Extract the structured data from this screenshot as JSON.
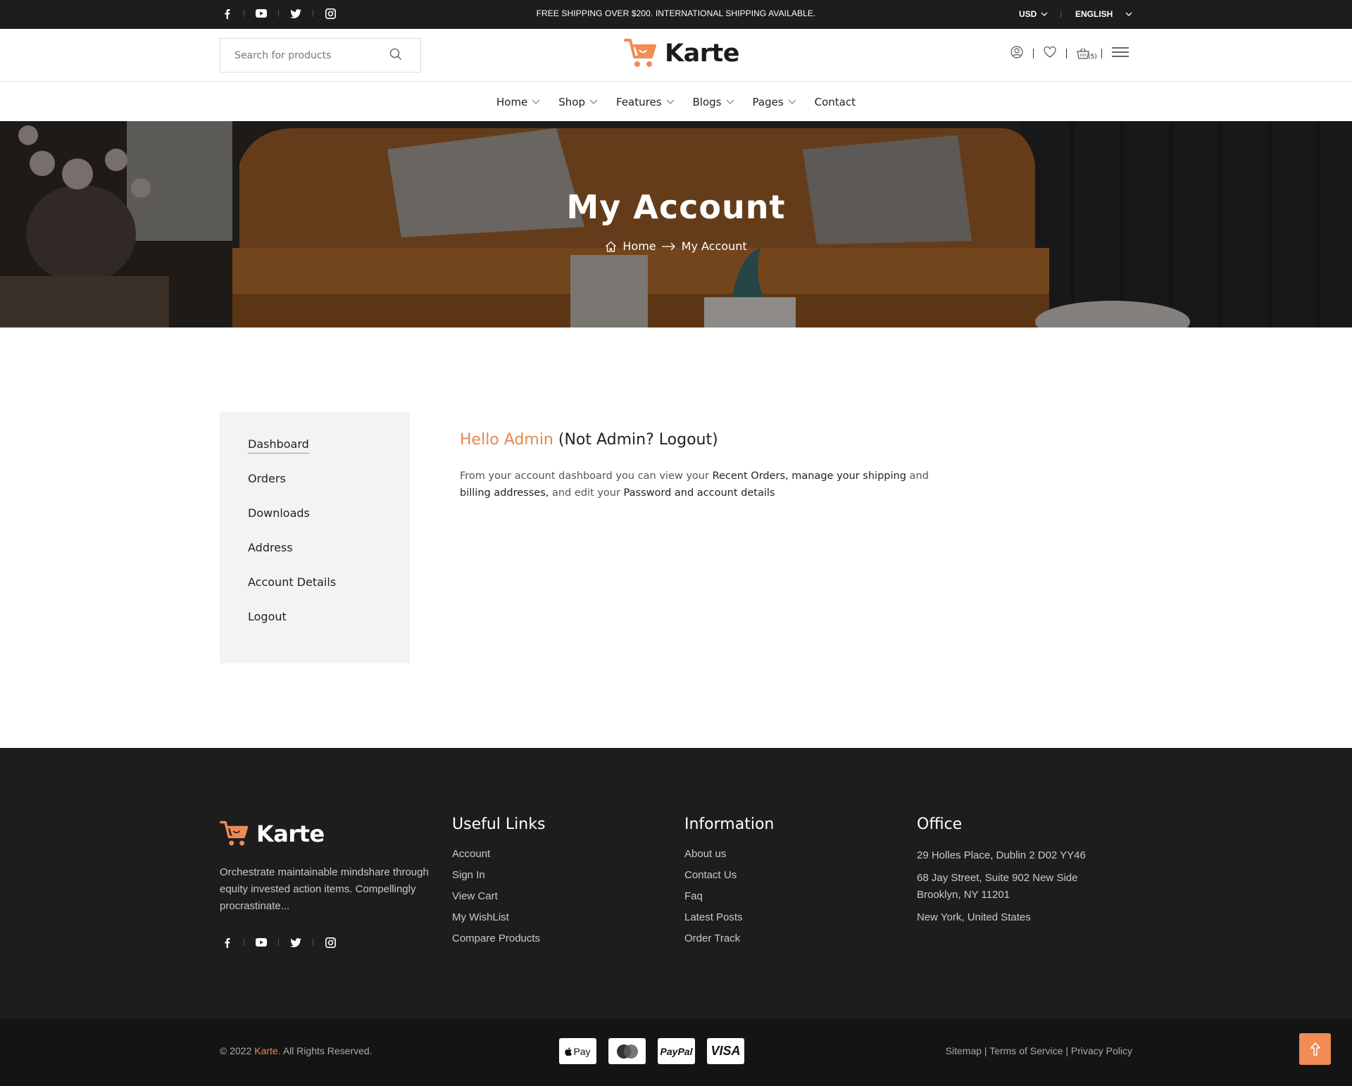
{
  "topbar": {
    "shipping_text": "FREE SHIPPING OVER $200. INTERNATIONAL SHIPPING AVAILABLE.",
    "currency": "USD",
    "language": "ENGLISH",
    "socials": [
      "facebook-icon",
      "youtube-icon",
      "twitter-icon",
      "instagram-icon"
    ]
  },
  "header": {
    "search_placeholder": "Search for products",
    "logo_text": "Karte",
    "cart_count": "(5)"
  },
  "nav": {
    "items": [
      {
        "label": "Home",
        "has_dropdown": true
      },
      {
        "label": "Shop",
        "has_dropdown": true
      },
      {
        "label": "Features",
        "has_dropdown": true
      },
      {
        "label": "Blogs",
        "has_dropdown": true
      },
      {
        "label": "Pages",
        "has_dropdown": true
      },
      {
        "label": "Contact",
        "has_dropdown": false
      }
    ]
  },
  "hero": {
    "title": "My Account",
    "breadcrumb_home": "Home",
    "breadcrumb_current": "My Account"
  },
  "account": {
    "menu": [
      {
        "label": "Dashboard",
        "active": true
      },
      {
        "label": "Orders"
      },
      {
        "label": "Downloads"
      },
      {
        "label": "Address"
      },
      {
        "label": "Account Details"
      },
      {
        "label": "Logout"
      }
    ],
    "greeting_name": "Hello Admin",
    "greeting_rest": "(Not Admin? Logout)",
    "desc_1": "From your account dashboard you can view your",
    "desc_recent": "Recent Orders,",
    "desc_manage": "manage your shipping",
    "desc_and": "and",
    "desc_billing": "billing addresses,",
    "desc_edit": "and edit your",
    "desc_password": "Password and account details"
  },
  "footer": {
    "logo_text": "Karte",
    "about": "Orchestrate maintainable mindshare through equity invested action items. Compellingly procrastinate...",
    "useful_title": "Useful Links",
    "useful_links": [
      "Account",
      "Sign In",
      "View Cart",
      "My WishList",
      "Compare Products"
    ],
    "info_title": "Information",
    "info_links": [
      "About us",
      "Contact Us",
      "Faq",
      "Latest Posts",
      "Order Track"
    ],
    "office_title": "Office",
    "office_lines": [
      "29 Holles Place, Dublin 2 D02 YY46",
      "68 Jay Street, Suite 902 New Side Brooklyn, NY 11201",
      "New York, United States"
    ]
  },
  "bottom": {
    "copyright_pre": "© 2022",
    "copyright_brand": "Karte.",
    "copyright_post": "All Rights Reserved.",
    "payments": [
      "Apple Pay",
      "Mastercard",
      "PayPal",
      "VISA"
    ],
    "pay_labels": [
      "Pay",
      "",
      "PayPal",
      "VISA"
    ],
    "links": [
      "Sitemap",
      "Terms of Service",
      "Privacy Policy"
    ]
  },
  "colors": {
    "accent": "#e8874b",
    "dark": "#1d1d1d"
  }
}
